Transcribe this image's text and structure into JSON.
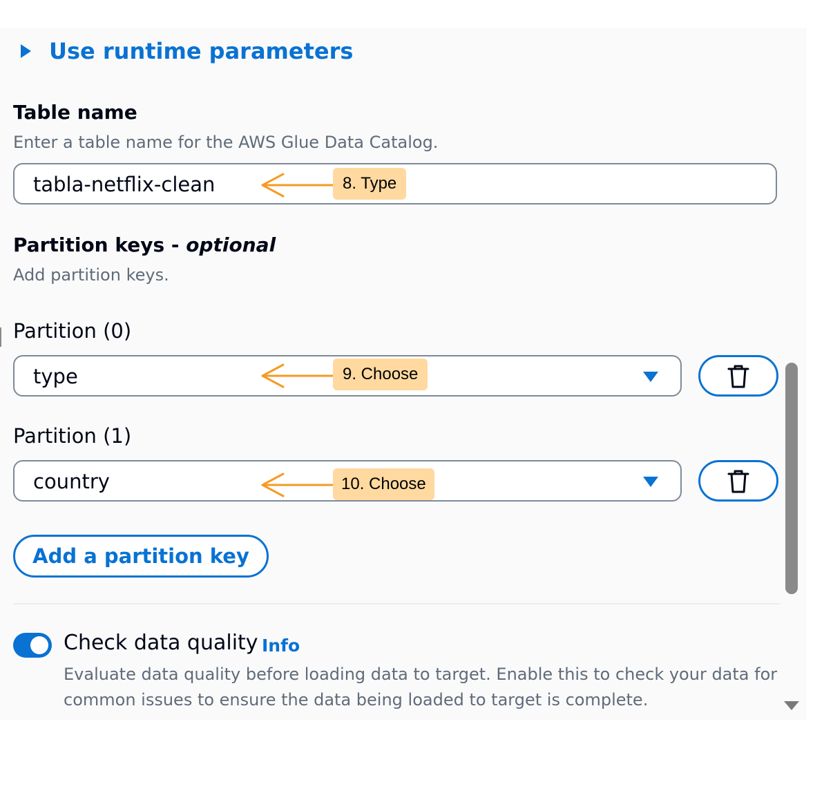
{
  "runtime_params": {
    "label": "Use runtime parameters"
  },
  "table_name": {
    "title": "Table name",
    "description": "Enter a table name for the AWS Glue Data Catalog.",
    "value": "tabla-netflix-clean"
  },
  "partition_keys": {
    "title": "Partition keys - ",
    "title_optional": "optional",
    "description": "Add partition keys.",
    "partitions": [
      {
        "label": "Partition (0)",
        "value": "type"
      },
      {
        "label": "Partition (1)",
        "value": "country"
      }
    ],
    "add_button": "Add a partition key"
  },
  "data_quality": {
    "label": "Check data quality",
    "info": "Info",
    "enabled": true,
    "description": "Evaluate data quality before loading data to target. Enable this to check your data for common issues to ensure the data being loaded to target is complete."
  },
  "annotations": [
    {
      "text": "8. Type"
    },
    {
      "text": "9. Choose"
    },
    {
      "text": "10. Choose"
    }
  ],
  "colors": {
    "accent": "#0972d3",
    "annotation_arrow": "#f59a23",
    "annotation_fill": "#ffd9a0"
  },
  "icons": {
    "delete": "trash-icon",
    "expand": "caret-right-icon",
    "dropdown": "caret-down-icon"
  }
}
